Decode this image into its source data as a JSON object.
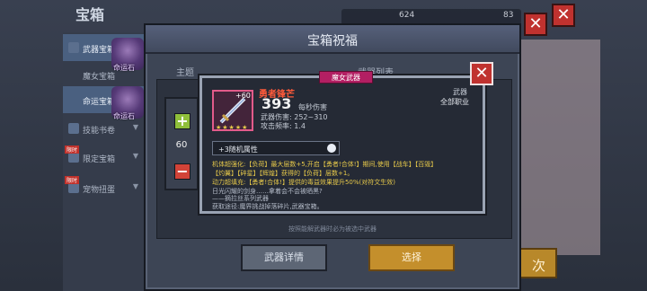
{
  "background": {
    "title": "宝箱",
    "currency1": "624",
    "currency2": "83"
  },
  "sidebar": {
    "items": [
      {
        "label": "武器宝箱",
        "badge": ""
      },
      {
        "label": "魔女宝箱",
        "badge": ""
      },
      {
        "label": "命运宝箱",
        "badge": ""
      },
      {
        "label": "技能书卷",
        "badge": ""
      },
      {
        "label": "限定宝箱",
        "badge": "限时"
      },
      {
        "label": "宠物扭蛋",
        "badge": "限时"
      }
    ],
    "figure_label": "命运石"
  },
  "modal": {
    "title": "宝箱祝福",
    "col_theme": "主题",
    "col_list": "武器列表",
    "hint": "按照能解武器时必为被选中武器",
    "btn_details": "武器详情",
    "btn_select": "选择"
  },
  "popup": {
    "tag": "魔女武器",
    "close_symbol": "✕",
    "quantity": {
      "plus": "+",
      "minus": "−",
      "value": "60"
    },
    "weapon": {
      "plus_level": "+60",
      "stars": "★★★★★",
      "name": "勇者锋芒",
      "dps": "393",
      "dps_label": "每秒伤害",
      "damage_label": "武器伤害:",
      "damage_value": "252~310",
      "rate_label": "攻击频率:",
      "rate_value": "1.4",
      "type_label": "武器",
      "job": "全部职业"
    },
    "random_attr": "+3随机属性",
    "desc": [
      "机体超强化:【负荷】最大层数+5,开启【勇者!合体!】期间,使用【战车】【百毁】",
      "【灼翼】【碎星】【辉煌】获得的【负荷】层数+1。",
      "动力超填充:【勇者!合体!】提供的毒益效果提升50%(对符文生效)",
      "日光闪耀的剑身……拿着会不会被晒黑?",
      "——摘拉丝系列武器",
      "获取途径:魔界挑战掉落碎片,武器宝箱。"
    ]
  },
  "right_button": "次",
  "colors": {
    "accent_red": "#c0322f",
    "gold": "#c48f2c",
    "tag_pink": "#b31f63",
    "weapon_name": "#ff5a3a"
  }
}
